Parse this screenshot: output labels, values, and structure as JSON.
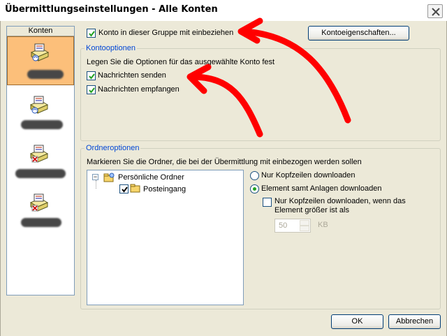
{
  "window": {
    "title": "Übermittlungseinstellungen - Alle Konten"
  },
  "accounts": {
    "header": "Konten",
    "items": [
      {
        "icon": "send-receive-account-icon",
        "selected": true
      },
      {
        "icon": "send-receive-account-icon",
        "selected": false
      },
      {
        "icon": "account-excluded-icon",
        "selected": false
      },
      {
        "icon": "account-excluded-icon",
        "selected": false
      }
    ]
  },
  "top": {
    "include_checkbox_label": "Konto in dieser Gruppe mit einbeziehen",
    "include_checked": true,
    "properties_button": "Kontoeigenschaften..."
  },
  "account_options": {
    "title": "Kontooptionen",
    "description": "Legen Sie die Optionen für das ausgewählte Konto fest",
    "send_label": "Nachrichten senden",
    "send_checked": true,
    "receive_label": "Nachrichten empfangen",
    "receive_checked": true
  },
  "folder_options": {
    "title": "Ordneroptionen",
    "description": "Markieren Sie die Ordner, die bei der Übermittlung mit einbezogen werden sollen",
    "tree": {
      "root_label": "Persönliche Ordner",
      "root_expander": "−",
      "child_label": "Posteingang",
      "child_checked": true
    },
    "radio_headers_only": "Nur Kopfzeilen downloaden",
    "radio_full_items": "Element samt Anlagen downloaden",
    "selected_radio": "full_items",
    "size_limit_label_line1": "Nur Kopfzeilen downloaden, wenn das",
    "size_limit_label_line2": "Element größer ist als",
    "size_limit_checked": false,
    "size_limit_value": "50",
    "size_limit_unit": "KB"
  },
  "buttons": {
    "ok": "OK",
    "cancel": "Abbrechen"
  },
  "colors": {
    "selected_account_bg": "#fcbf7a",
    "group_title": "#0046d5",
    "annotation_arrow": "#ff0000"
  }
}
